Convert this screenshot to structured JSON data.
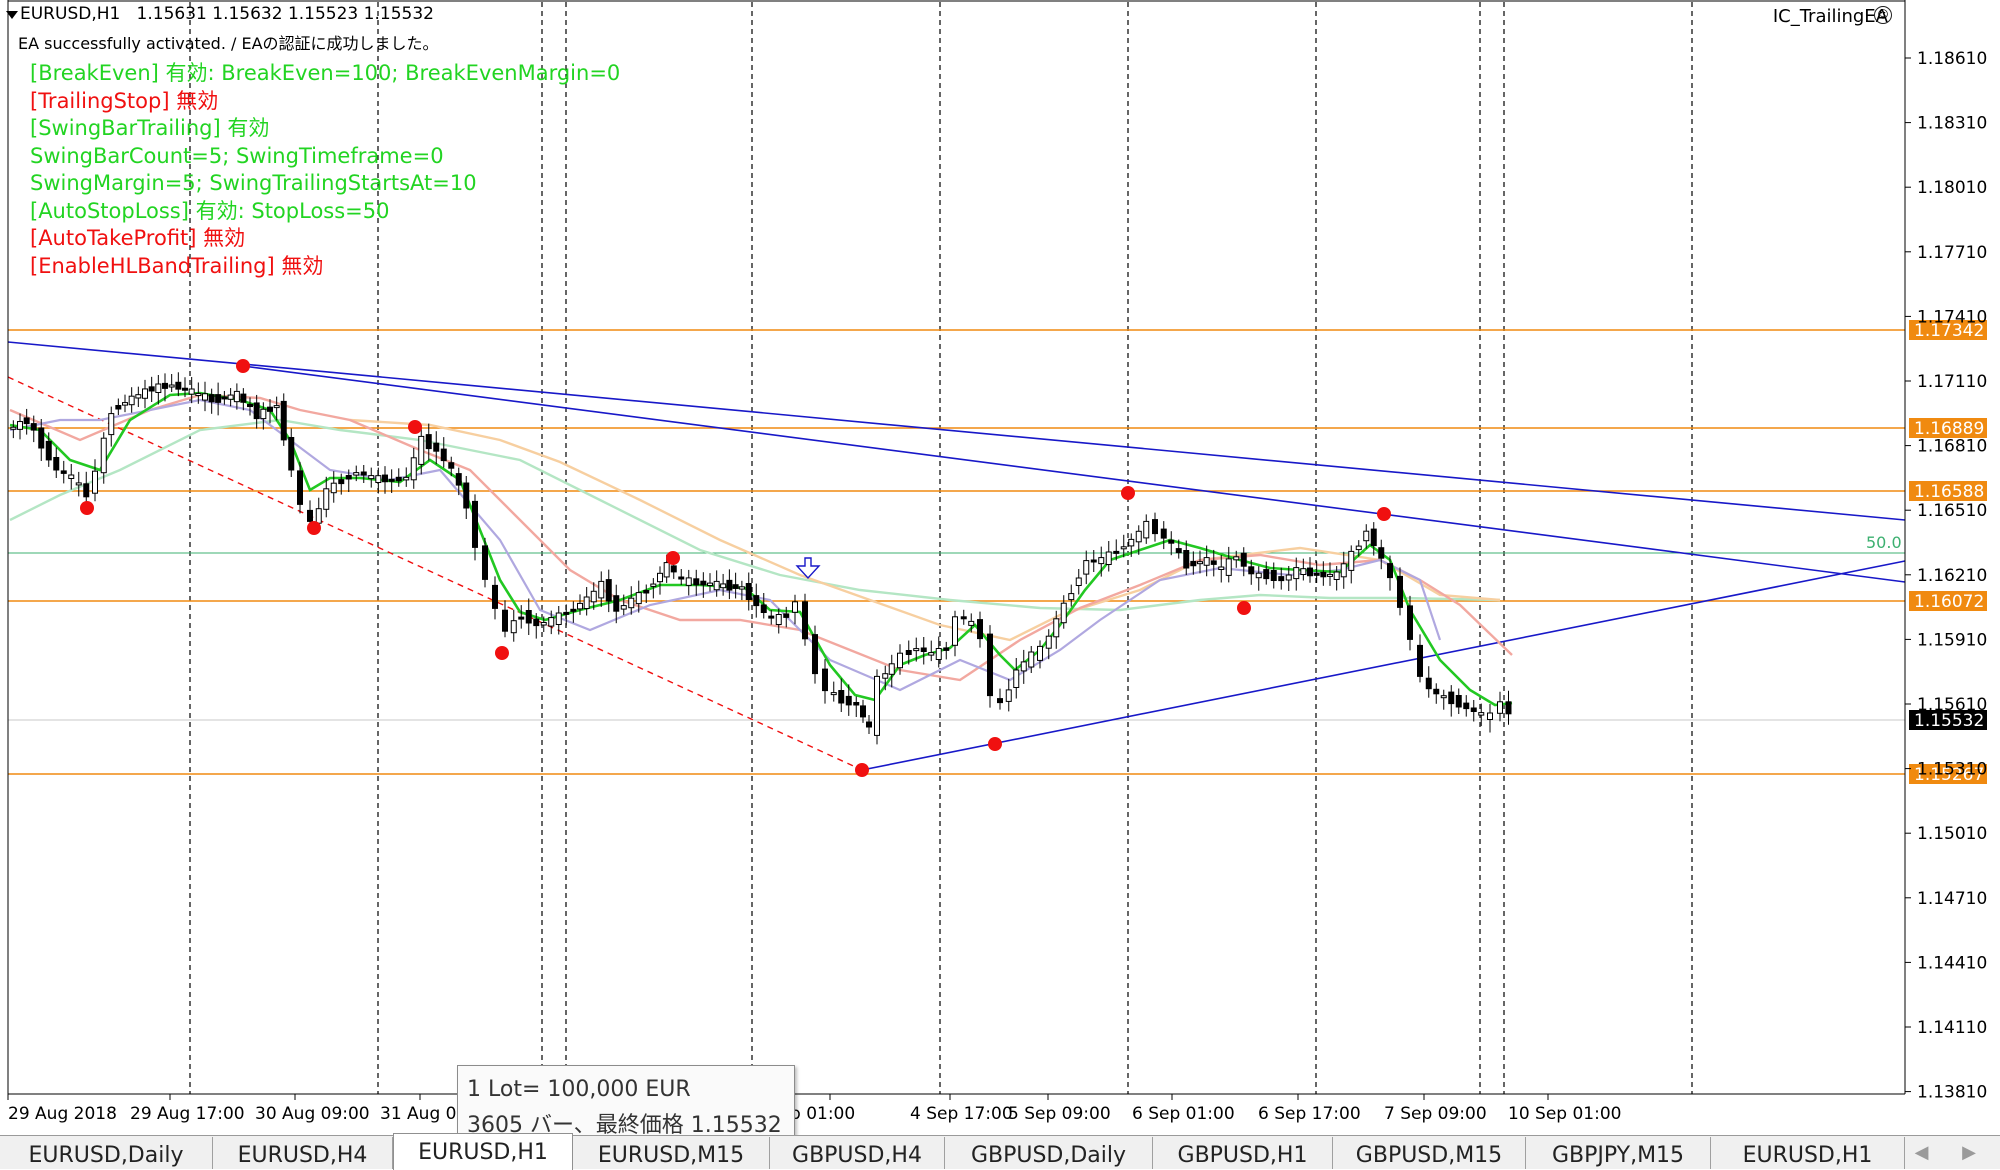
{
  "chart": {
    "header": {
      "symbol": "EURUSD,H1",
      "ohlc": "1.15631 1.15632 1.15523 1.15532"
    },
    "status_message": "EA successfully activated. / EAの認証に成功しました。",
    "ea_name": "IC_TrailingEA",
    "ea_icon": "smiley-face-icon",
    "info_lines": [
      {
        "text": "[BreakEven] 有効: BreakEven=100; BreakEvenMargin=0",
        "color": "#22d422"
      },
      {
        "text": "[TrailingStop] 無効",
        "color": "#f01010"
      },
      {
        "text": "[SwingBarTrailing] 有効",
        "color": "#22d422"
      },
      {
        "text": "SwingBarCount=5; SwingTimeframe=0",
        "color": "#22d422"
      },
      {
        "text": "SwingMargin=5; SwingTrailingStartsAt=10",
        "color": "#22d422"
      },
      {
        "text": "[AutoStopLoss] 有効: StopLoss=50",
        "color": "#22d422"
      },
      {
        "text": "[AutoTakeProfit] 無効",
        "color": "#f01010"
      },
      {
        "text": "[EnableHLBandTrailing] 無効",
        "color": "#f01010"
      }
    ],
    "price_axis": [
      "1.18610",
      "1.18310",
      "1.18010",
      "1.17710",
      "1.17410",
      "1.17110",
      "1.16810",
      "1.16510",
      "1.16210",
      "1.15910",
      "1.15610",
      "1.15310",
      "1.15010",
      "1.14710",
      "1.14410",
      "1.14110",
      "1.13810"
    ],
    "time_axis": [
      "29 Aug 2018",
      "29 Aug 17:00",
      "30 Aug 09:00",
      "31 Aug 0",
      "p 01:00",
      "4 Sep 17:00",
      "5 Sep 09:00",
      "6 Sep 01:00",
      "6 Sep 17:00",
      "7 Sep 09:00",
      "10 Sep 01:00"
    ],
    "price_tags": [
      {
        "label": "1.17342",
        "kind": "orange"
      },
      {
        "label": "1.16889",
        "kind": "orange"
      },
      {
        "label": "1.16588",
        "kind": "orange"
      },
      {
        "label": "1.16072",
        "kind": "orange"
      },
      {
        "label": "1.15532",
        "kind": "current"
      },
      {
        "label": "1.15267",
        "kind": "orange"
      }
    ],
    "fib_label": "50.0",
    "current_price": "1.15532",
    "colors": {
      "bull": "#000000",
      "bear": "#000000",
      "ma_fast": "#22c822",
      "ma_mid": "#f2a8a0",
      "ma_slow": "#f7cfa0",
      "ma_long": "#b4e6c4",
      "ma_purple": "#b0a8e0",
      "level": "#f08a10",
      "trend": "#1818c8",
      "pivot": "#f01010"
    }
  },
  "tooltip": {
    "line1": "1 Lot= 100,000 EUR",
    "line2": "3605 バー、最終価格 1.15532"
  },
  "tabs": [
    {
      "label": "EURUSD,Daily",
      "active": false
    },
    {
      "label": "EURUSD,H4",
      "active": false
    },
    {
      "label": "EURUSD,H1",
      "active": true
    },
    {
      "label": "EURUSD,M15",
      "active": false
    },
    {
      "label": "GBPUSD,H4",
      "active": false
    },
    {
      "label": "GBPUSD,Daily",
      "active": false
    },
    {
      "label": "GBPUSD,H1",
      "active": false
    },
    {
      "label": "GBPUSD,M15",
      "active": false
    },
    {
      "label": "GBPJPY,M15",
      "active": false
    },
    {
      "label": "EURUSD,H1",
      "active": false
    }
  ],
  "tab_scroll": "◀ ▶"
}
